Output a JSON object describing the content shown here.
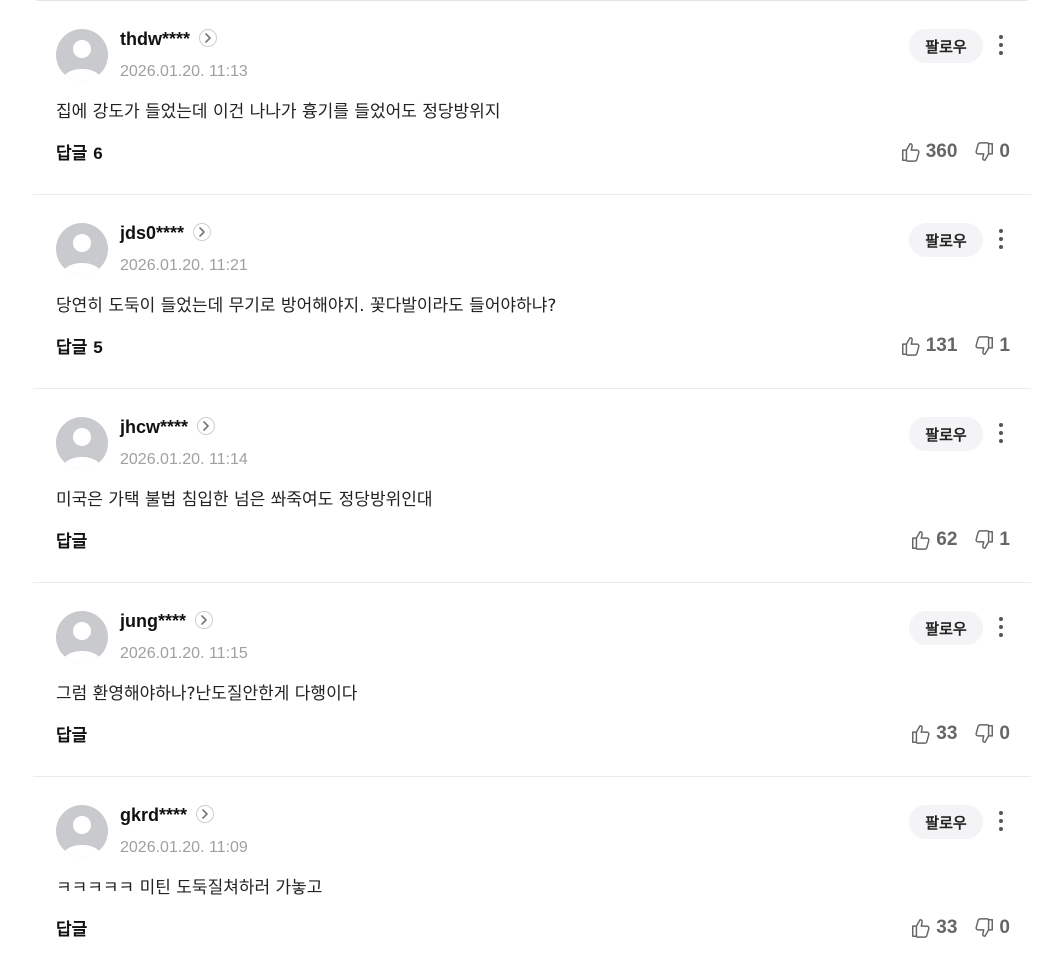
{
  "comments": [
    {
      "username": "thdw****",
      "date": "2026.01.20. 11:13",
      "text": "집에 강도가 들었는데 이건 나나가 흉기를 들었어도 정당방위지",
      "reply_label": "답글",
      "reply_count": "6",
      "likes": "360",
      "dislikes": "0",
      "follow_label": "팔로우"
    },
    {
      "username": "jds0****",
      "date": "2026.01.20. 11:21",
      "text": "당연히 도둑이 들었는데 무기로 방어해야지. 꽃다발이라도 들어야하냐?",
      "reply_label": "답글",
      "reply_count": "5",
      "likes": "131",
      "dislikes": "1",
      "follow_label": "팔로우"
    },
    {
      "username": "jhcw****",
      "date": "2026.01.20. 11:14",
      "text": "미국은 가택 불법 침입한 넘은 쏴죽여도 정당방위인대",
      "reply_label": "답글",
      "reply_count": "",
      "likes": "62",
      "dislikes": "1",
      "follow_label": "팔로우"
    },
    {
      "username": "jung****",
      "date": "2026.01.20. 11:15",
      "text": "그럼 환영해야하나?난도질안한게 다행이다",
      "reply_label": "답글",
      "reply_count": "",
      "likes": "33",
      "dislikes": "0",
      "follow_label": "팔로우"
    },
    {
      "username": "gkrd****",
      "date": "2026.01.20. 11:09",
      "text": "ㅋㅋㅋㅋㅋ 미틴 도둑질쳐하러 가놓고",
      "reply_label": "답글",
      "reply_count": "",
      "likes": "33",
      "dislikes": "0",
      "follow_label": "팔로우"
    }
  ]
}
